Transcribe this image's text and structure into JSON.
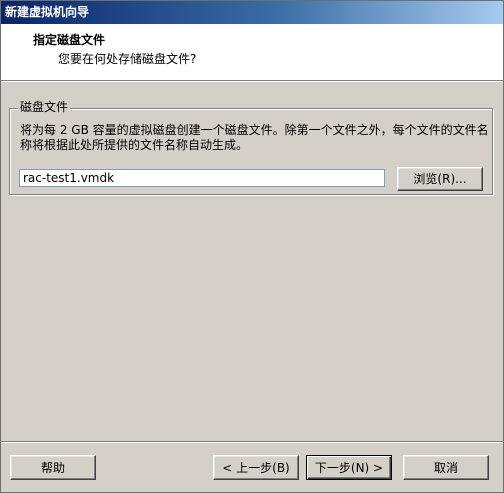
{
  "window": {
    "title": "新建虚拟机向导"
  },
  "header": {
    "title": "指定磁盘文件",
    "subtitle": "您要在何处存储磁盘文件?"
  },
  "disk_group": {
    "label": "磁盘文件",
    "description": "将为每 2 GB 容量的虚拟磁盘创建一个磁盘文件。除第一个文件之外，每个文件的文件名称将根据此处所提供的文件名称自动生成。",
    "file_value": "rac-test1.vmdk",
    "browse_label": "浏览(R)..."
  },
  "footer": {
    "help_label": "帮助",
    "back_label": "< 上一步(B)",
    "next_label": "下一步(N) >",
    "cancel_label": "取消"
  }
}
